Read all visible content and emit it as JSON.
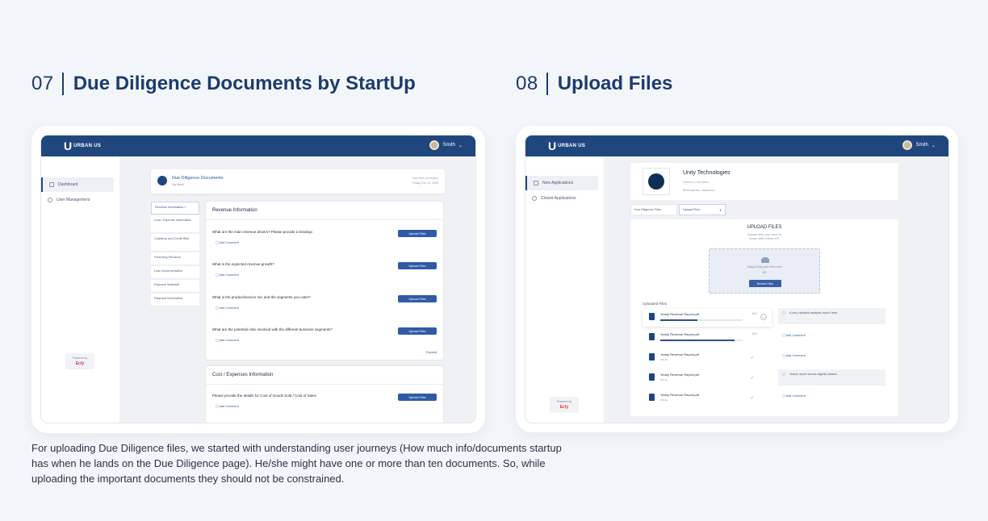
{
  "section07": {
    "number": "07",
    "title": "Due Diligence Documents by StartUp"
  },
  "section08": {
    "number": "08",
    "title": "Upload Files"
  },
  "app": {
    "logo_mark": "U",
    "logo_text": "URBAN US",
    "user_name": "Smith",
    "powered_by": "Powered by",
    "brand": "Ecfy"
  },
  "screen1": {
    "sidebar": [
      "Dashboard",
      "User Management"
    ],
    "header": {
      "title": "Due Diligence Documents",
      "subtitle": "Up Next",
      "last_label": "Last Tech Correction",
      "last_date": "Friday, Dec 13, 2020"
    },
    "tabs": [
      "Revenue Information",
      "Cost / Expense Information",
      "Collateral and Credit Risk",
      "Financing Structure",
      "Loan Documentation",
      "Payment Waterfall",
      "Financial Information"
    ],
    "revenue": {
      "title": "Revenue Information",
      "questions": [
        "What are the main revenue drivers? Please provide a breakup",
        "What is the expected revenue growth?",
        "What is the product/service mix and the segments you cater?",
        "What are the potential risks involved with the different business segments?"
      ],
      "upload_label": "Upload Files",
      "comment_label": "Add Comment",
      "expand_label": "Expand"
    },
    "cost": {
      "title": "Cost / Expenses Information",
      "question": "Please provide the details for Cost of Goods Sold / Cost of Sales"
    }
  },
  "screen2": {
    "sidebar": [
      "New Applications",
      "Closed Applications"
    ],
    "company": {
      "name": "Unity Technologies",
      "sub": "Onlines | Vehicles",
      "location": "Birmingham, Alabama"
    },
    "tabs": [
      "Due Diligence Files",
      "Upload Files"
    ],
    "upload": {
      "title": "UPLOAD FILES",
      "subtitle": "Upload files you want to share with Urban US",
      "drop_text": "Drag & Drop your Files here",
      "or": "OR",
      "browse": "Browse Files",
      "uploaded_label": "Uploaded Files"
    },
    "files": [
      {
        "name": "Yearly Revenue Report.pdf",
        "size": "",
        "percent": "40%",
        "progress": 0.45,
        "comment": "A very detailed analysis report here."
      },
      {
        "name": "Yearly Revenue Report.pdf",
        "size": "",
        "percent": "90%",
        "progress": 0.9,
        "comment": ""
      },
      {
        "name": "Yearly Revenue Report.pdf",
        "size": "870 kb",
        "percent": "",
        "progress": 1,
        "comment": ""
      },
      {
        "name": "Yearly Revenue Report.pdf",
        "size": "870 kb",
        "percent": "",
        "progress": 1,
        "comment": "Yearly report seems slightly biased."
      },
      {
        "name": "Yearly Revenue Report.pdf",
        "size": "870 kb",
        "percent": "",
        "progress": 1,
        "comment": ""
      }
    ],
    "comment_label": "Add Comment"
  },
  "caption": "For uploading Due Diligence files, we started with understanding user journeys (How much info/documents startup has when he lands on the Due Diligence page). He/she might have one or more than ten documents. So, while uploading the important documents they should not be constrained."
}
